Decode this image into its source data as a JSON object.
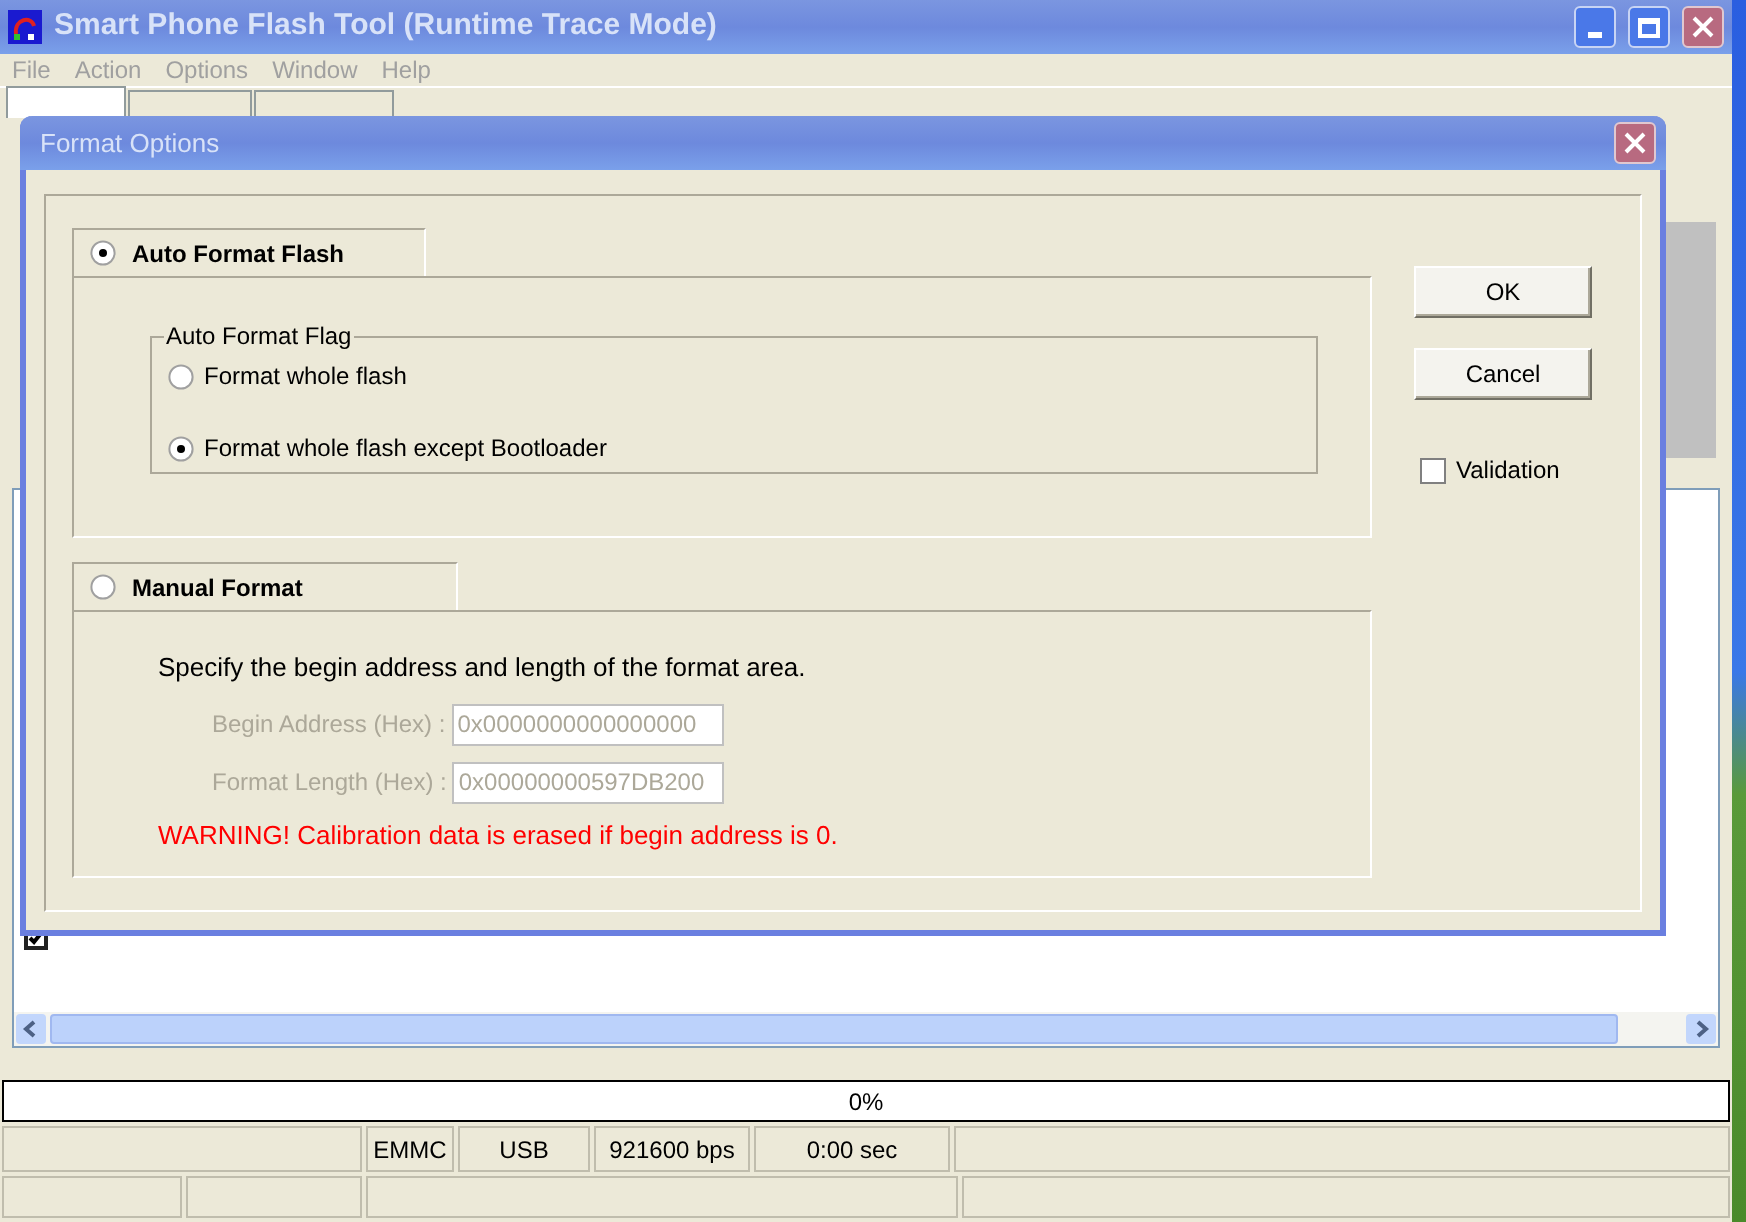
{
  "window": {
    "title": "Smart Phone Flash Tool (Runtime Trace Mode)"
  },
  "menu": [
    "File",
    "Action",
    "Options",
    "Window",
    "Help"
  ],
  "tabs": [
    {
      "selected": true
    },
    {
      "selected": false
    },
    {
      "selected": false
    }
  ],
  "list": {
    "rows": [
      {
        "checked": true
      }
    ]
  },
  "progress": {
    "text": "0%",
    "level": 0
  },
  "status_bar": {
    "cells": [
      "EMMC",
      "USB",
      "921600 bps",
      "0:00 sec"
    ]
  },
  "dialog": {
    "title": "Format Options",
    "auto_format": {
      "label": "Auto Format Flash",
      "selected": true,
      "group_title": "Auto Format Flag",
      "options": [
        {
          "label": "Format whole flash",
          "selected": false
        },
        {
          "label": "Format whole flash except Bootloader",
          "selected": true
        }
      ]
    },
    "manual_format": {
      "label": "Manual Format",
      "selected": false,
      "description": "Specify the begin address and length of the format area.",
      "fields": [
        {
          "label": "Begin Address (Hex) :",
          "value": "0x0000000000000000",
          "disabled": true
        },
        {
          "label": "Format Length (Hex) :",
          "value": "0x00000000597DB200",
          "disabled": true
        }
      ],
      "warning": "WARNING! Calibration data is erased if begin address is 0."
    },
    "buttons": [
      "OK",
      "Cancel"
    ],
    "validation": {
      "label": "Validation",
      "checked": false
    }
  }
}
